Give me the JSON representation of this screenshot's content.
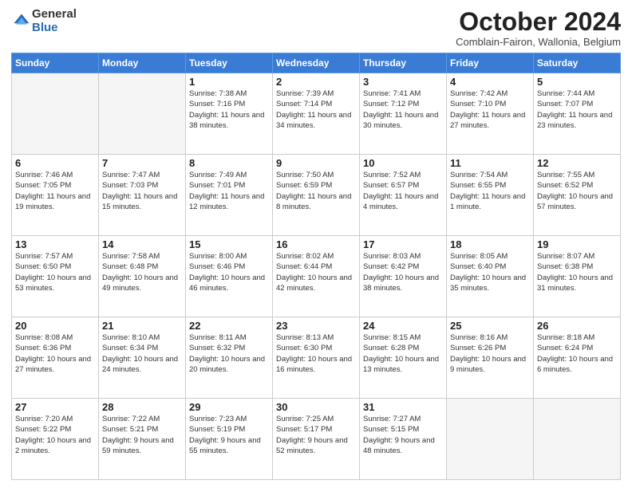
{
  "logo": {
    "general": "General",
    "blue": "Blue"
  },
  "header": {
    "month": "October 2024",
    "subtitle": "Comblain-Fairon, Wallonia, Belgium"
  },
  "weekdays": [
    "Sunday",
    "Monday",
    "Tuesday",
    "Wednesday",
    "Thursday",
    "Friday",
    "Saturday"
  ],
  "weeks": [
    [
      {
        "day": "",
        "info": ""
      },
      {
        "day": "",
        "info": ""
      },
      {
        "day": "1",
        "info": "Sunrise: 7:38 AM\nSunset: 7:16 PM\nDaylight: 11 hours and 38 minutes."
      },
      {
        "day": "2",
        "info": "Sunrise: 7:39 AM\nSunset: 7:14 PM\nDaylight: 11 hours and 34 minutes."
      },
      {
        "day": "3",
        "info": "Sunrise: 7:41 AM\nSunset: 7:12 PM\nDaylight: 11 hours and 30 minutes."
      },
      {
        "day": "4",
        "info": "Sunrise: 7:42 AM\nSunset: 7:10 PM\nDaylight: 11 hours and 27 minutes."
      },
      {
        "day": "5",
        "info": "Sunrise: 7:44 AM\nSunset: 7:07 PM\nDaylight: 11 hours and 23 minutes."
      }
    ],
    [
      {
        "day": "6",
        "info": "Sunrise: 7:46 AM\nSunset: 7:05 PM\nDaylight: 11 hours and 19 minutes."
      },
      {
        "day": "7",
        "info": "Sunrise: 7:47 AM\nSunset: 7:03 PM\nDaylight: 11 hours and 15 minutes."
      },
      {
        "day": "8",
        "info": "Sunrise: 7:49 AM\nSunset: 7:01 PM\nDaylight: 11 hours and 12 minutes."
      },
      {
        "day": "9",
        "info": "Sunrise: 7:50 AM\nSunset: 6:59 PM\nDaylight: 11 hours and 8 minutes."
      },
      {
        "day": "10",
        "info": "Sunrise: 7:52 AM\nSunset: 6:57 PM\nDaylight: 11 hours and 4 minutes."
      },
      {
        "day": "11",
        "info": "Sunrise: 7:54 AM\nSunset: 6:55 PM\nDaylight: 11 hours and 1 minute."
      },
      {
        "day": "12",
        "info": "Sunrise: 7:55 AM\nSunset: 6:52 PM\nDaylight: 10 hours and 57 minutes."
      }
    ],
    [
      {
        "day": "13",
        "info": "Sunrise: 7:57 AM\nSunset: 6:50 PM\nDaylight: 10 hours and 53 minutes."
      },
      {
        "day": "14",
        "info": "Sunrise: 7:58 AM\nSunset: 6:48 PM\nDaylight: 10 hours and 49 minutes."
      },
      {
        "day": "15",
        "info": "Sunrise: 8:00 AM\nSunset: 6:46 PM\nDaylight: 10 hours and 46 minutes."
      },
      {
        "day": "16",
        "info": "Sunrise: 8:02 AM\nSunset: 6:44 PM\nDaylight: 10 hours and 42 minutes."
      },
      {
        "day": "17",
        "info": "Sunrise: 8:03 AM\nSunset: 6:42 PM\nDaylight: 10 hours and 38 minutes."
      },
      {
        "day": "18",
        "info": "Sunrise: 8:05 AM\nSunset: 6:40 PM\nDaylight: 10 hours and 35 minutes."
      },
      {
        "day": "19",
        "info": "Sunrise: 8:07 AM\nSunset: 6:38 PM\nDaylight: 10 hours and 31 minutes."
      }
    ],
    [
      {
        "day": "20",
        "info": "Sunrise: 8:08 AM\nSunset: 6:36 PM\nDaylight: 10 hours and 27 minutes."
      },
      {
        "day": "21",
        "info": "Sunrise: 8:10 AM\nSunset: 6:34 PM\nDaylight: 10 hours and 24 minutes."
      },
      {
        "day": "22",
        "info": "Sunrise: 8:11 AM\nSunset: 6:32 PM\nDaylight: 10 hours and 20 minutes."
      },
      {
        "day": "23",
        "info": "Sunrise: 8:13 AM\nSunset: 6:30 PM\nDaylight: 10 hours and 16 minutes."
      },
      {
        "day": "24",
        "info": "Sunrise: 8:15 AM\nSunset: 6:28 PM\nDaylight: 10 hours and 13 minutes."
      },
      {
        "day": "25",
        "info": "Sunrise: 8:16 AM\nSunset: 6:26 PM\nDaylight: 10 hours and 9 minutes."
      },
      {
        "day": "26",
        "info": "Sunrise: 8:18 AM\nSunset: 6:24 PM\nDaylight: 10 hours and 6 minutes."
      }
    ],
    [
      {
        "day": "27",
        "info": "Sunrise: 7:20 AM\nSunset: 5:22 PM\nDaylight: 10 hours and 2 minutes."
      },
      {
        "day": "28",
        "info": "Sunrise: 7:22 AM\nSunset: 5:21 PM\nDaylight: 9 hours and 59 minutes."
      },
      {
        "day": "29",
        "info": "Sunrise: 7:23 AM\nSunset: 5:19 PM\nDaylight: 9 hours and 55 minutes."
      },
      {
        "day": "30",
        "info": "Sunrise: 7:25 AM\nSunset: 5:17 PM\nDaylight: 9 hours and 52 minutes."
      },
      {
        "day": "31",
        "info": "Sunrise: 7:27 AM\nSunset: 5:15 PM\nDaylight: 9 hours and 48 minutes."
      },
      {
        "day": "",
        "info": ""
      },
      {
        "day": "",
        "info": ""
      }
    ]
  ]
}
